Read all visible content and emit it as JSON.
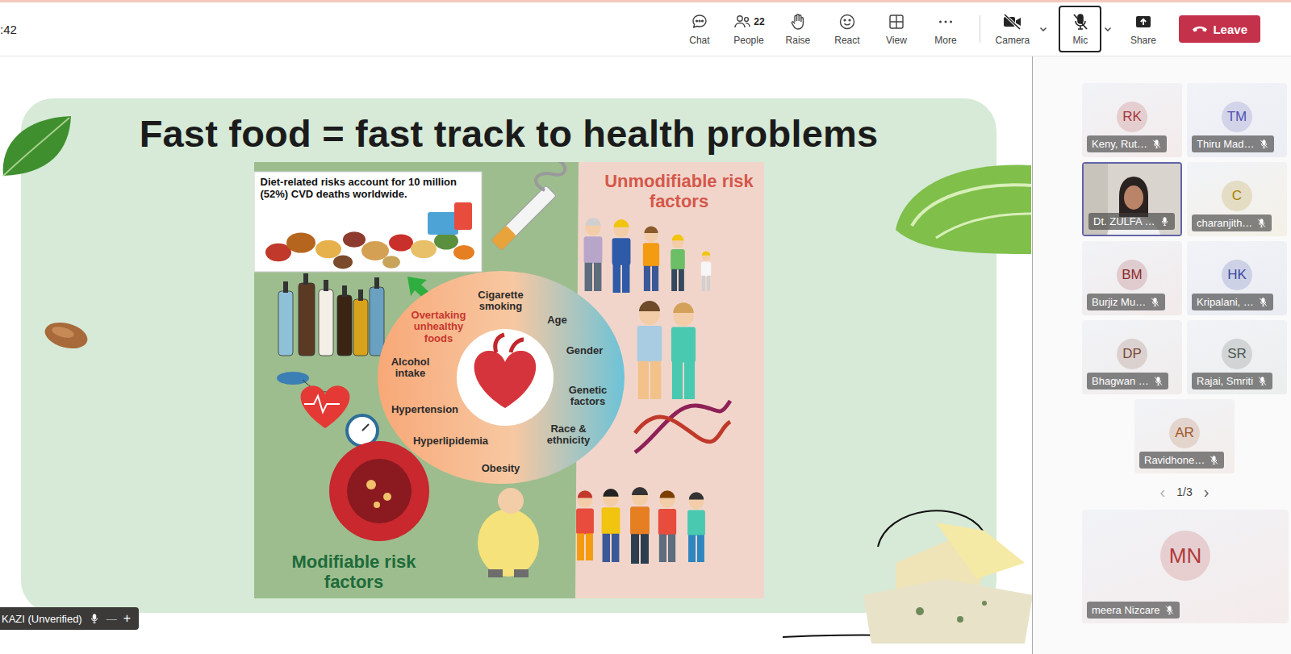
{
  "meeting": {
    "time": ":42"
  },
  "toolbar": [
    {
      "label": "Chat"
    },
    {
      "label": "People",
      "count": "22"
    },
    {
      "label": "Raise"
    },
    {
      "label": "React"
    },
    {
      "label": "View"
    },
    {
      "label": "More"
    }
  ],
  "devices": [
    {
      "label": "Camera",
      "on": false,
      "selected": false
    },
    {
      "label": "Mic",
      "on": false,
      "selected": true
    }
  ],
  "share": {
    "label": "Share"
  },
  "leave": {
    "label": "Leave"
  },
  "slide": {
    "title": "Fast food = fast track to health problems",
    "infographic": {
      "note": "Diet-related risks account for 10 million (52%) CVD deaths worldwide.",
      "unmodifiable_heading": "Unmodifiable risk factors",
      "modifiable_heading": "Modifiable risk factors",
      "factors": [
        {
          "label": "Cigarette smoking",
          "color": "#2b2b2b"
        },
        {
          "label": "Overtaking unhealthy foods",
          "color": "#c8372d"
        },
        {
          "label": "Alcohol intake",
          "color": "#2b2b2b"
        },
        {
          "label": "Hypertension",
          "color": "#2b2b2b"
        },
        {
          "label": "Hyperlipidemia",
          "color": "#2b2b2b"
        },
        {
          "label": "Obesity",
          "color": "#2b2b2b"
        },
        {
          "label": "Age",
          "color": "#2b2b2b"
        },
        {
          "label": "Gender",
          "color": "#2b2b2b"
        },
        {
          "label": "Genetic factors",
          "color": "#2b2b2b"
        },
        {
          "label": "Race & ethnicity",
          "color": "#2b2b2b"
        }
      ]
    }
  },
  "presenter": {
    "name": "KAZI (Unverified)",
    "muted": false,
    "minimize": "—",
    "add": "+"
  },
  "participants": [
    {
      "initials": "RK",
      "name": "Keny, Rut…",
      "muted": true,
      "video": false,
      "selected": false,
      "color": "#a4373a"
    },
    {
      "initials": "TM",
      "name": "Thiru Mad…",
      "muted": true,
      "video": false,
      "selected": false,
      "color": "#4f52b2"
    },
    {
      "name": "Dt. ZULFA …",
      "muted": false,
      "video": true,
      "selected": true
    },
    {
      "initials": "C",
      "name": "charanjith…",
      "muted": true,
      "video": false,
      "selected": false,
      "color": "#a67f00"
    },
    {
      "initials": "BM",
      "name": "Burjiz Mu…",
      "muted": true,
      "video": false,
      "selected": false,
      "color": "#8e2a30"
    },
    {
      "initials": "HK",
      "name": "Kripalani, …",
      "muted": true,
      "video": false,
      "selected": false,
      "color": "#3a4aa3"
    },
    {
      "initials": "DP",
      "name": "Bhagwan …",
      "muted": true,
      "video": false,
      "selected": false,
      "color": "#7a4a3a"
    },
    {
      "initials": "SR",
      "name": "Rajai, Smriti",
      "muted": true,
      "video": false,
      "selected": false,
      "color": "#4b5a52"
    },
    {
      "initials": "AR",
      "name": "Ravidhone…",
      "muted": true,
      "video": false,
      "selected": false,
      "color": "#a0562a"
    }
  ],
  "pager": {
    "prev": "‹",
    "label": "1/3",
    "next": "›"
  },
  "spotlight": {
    "initials": "MN",
    "name": "meera Nizcare",
    "muted": true,
    "color": "#b03a3a"
  }
}
